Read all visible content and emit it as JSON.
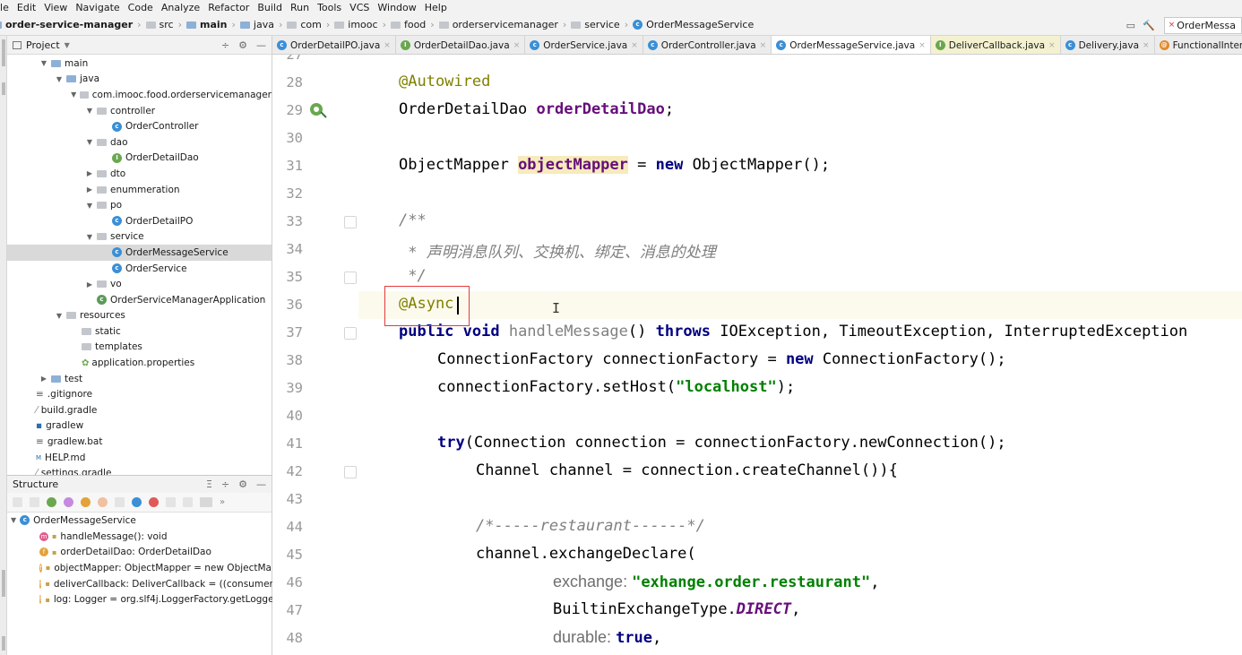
{
  "menu": [
    "ile",
    "Edit",
    "View",
    "Navigate",
    "Code",
    "Analyze",
    "Refactor",
    "Build",
    "Run",
    "Tools",
    "VCS",
    "Window",
    "Help"
  ],
  "breadcrumb": [
    "order-service-manager",
    "src",
    "main",
    "java",
    "com",
    "imooc",
    "food",
    "orderservicemanager",
    "service",
    "OrderMessageService"
  ],
  "nav_right_tab": "OrderMessa",
  "project_panel": {
    "title": "Project",
    "tree": [
      {
        "label": "main",
        "indent": 0,
        "arrow": "down",
        "icon": "folder-blue"
      },
      {
        "label": "java",
        "indent": 1,
        "arrow": "down",
        "icon": "folder-blue"
      },
      {
        "label": "com.imooc.food.orderservicemanager",
        "indent": 2,
        "arrow": "down",
        "icon": "folder"
      },
      {
        "label": "controller",
        "indent": 3,
        "arrow": "down",
        "icon": "folder"
      },
      {
        "label": "OrderController",
        "indent": 4,
        "arrow": "",
        "icon": "class"
      },
      {
        "label": "dao",
        "indent": 3,
        "arrow": "down",
        "icon": "folder"
      },
      {
        "label": "OrderDetailDao",
        "indent": 4,
        "arrow": "",
        "icon": "interface"
      },
      {
        "label": "dto",
        "indent": 3,
        "arrow": "right",
        "icon": "folder"
      },
      {
        "label": "enummeration",
        "indent": 3,
        "arrow": "right",
        "icon": "folder"
      },
      {
        "label": "po",
        "indent": 3,
        "arrow": "down",
        "icon": "folder"
      },
      {
        "label": "OrderDetailPO",
        "indent": 4,
        "arrow": "",
        "icon": "class"
      },
      {
        "label": "service",
        "indent": 3,
        "arrow": "down",
        "icon": "folder"
      },
      {
        "label": "OrderMessageService",
        "indent": 4,
        "arrow": "",
        "icon": "class",
        "selected": true
      },
      {
        "label": "OrderService",
        "indent": 4,
        "arrow": "",
        "icon": "class"
      },
      {
        "label": "vo",
        "indent": 3,
        "arrow": "right",
        "icon": "folder"
      },
      {
        "label": "OrderServiceManagerApplication",
        "indent": 3,
        "arrow": "",
        "icon": "app"
      },
      {
        "label": "resources",
        "indent": 1,
        "arrow": "down",
        "icon": "folder"
      },
      {
        "label": "static",
        "indent": 2,
        "arrow": "",
        "icon": "folder"
      },
      {
        "label": "templates",
        "indent": 2,
        "arrow": "",
        "icon": "folder"
      },
      {
        "label": "application.properties",
        "indent": 2,
        "arrow": "",
        "icon": "props"
      },
      {
        "label": "test",
        "indent": 0,
        "arrow": "right",
        "icon": "folder-blue"
      },
      {
        "label": ".gitignore",
        "indent": -1,
        "arrow": "",
        "icon": "file"
      },
      {
        "label": "build.gradle",
        "indent": -1,
        "arrow": "",
        "icon": "gradle"
      },
      {
        "label": "gradlew",
        "indent": -1,
        "arrow": "",
        "icon": "exec"
      },
      {
        "label": "gradlew.bat",
        "indent": -1,
        "arrow": "",
        "icon": "file"
      },
      {
        "label": "HELP.md",
        "indent": -1,
        "arrow": "",
        "icon": "md"
      },
      {
        "label": "settings.gradle",
        "indent": -1,
        "arrow": "",
        "icon": "gradle"
      }
    ]
  },
  "structure_panel": {
    "title": "Structure",
    "root": "OrderMessageService",
    "items": [
      {
        "badge": "m",
        "label": "handleMessage(): void"
      },
      {
        "badge": "f",
        "label": "orderDetailDao: OrderDetailDao"
      },
      {
        "badge": "f",
        "label": "objectMapper: ObjectMapper = new ObjectMa"
      },
      {
        "badge": "f",
        "label": "deliverCallback: DeliverCallback = ((consumerTa"
      },
      {
        "badge": "f",
        "label": "log: Logger = org.slf4j.LoggerFactory.getLogge"
      }
    ]
  },
  "tabs": [
    {
      "label": "OrderDetailPO.java",
      "icon": "class"
    },
    {
      "label": "OrderDetailDao.java",
      "icon": "interface"
    },
    {
      "label": "OrderService.java",
      "icon": "class"
    },
    {
      "label": "OrderController.java",
      "icon": "class"
    },
    {
      "label": "OrderMessageService.java",
      "icon": "class",
      "active": true
    },
    {
      "label": "DeliverCallback.java",
      "icon": "interface",
      "iface": true
    },
    {
      "label": "Delivery.java",
      "icon": "class"
    },
    {
      "label": "FunctionalInterface.java",
      "icon": "annotation"
    }
  ],
  "editor": {
    "first_partial_line": "27",
    "current_line": "36",
    "lines": [
      {
        "n": "28",
        "indent": 0,
        "tokens": [
          [
            "ann",
            "@Autowired"
          ]
        ]
      },
      {
        "n": "29",
        "indent": 0,
        "tokens": [
          [
            "",
            "OrderDetailDao "
          ],
          [
            "fld",
            "orderDetailDao"
          ],
          [
            "",
            ";"
          ]
        ],
        "gicon": true
      },
      {
        "n": "30",
        "indent": 0,
        "tokens": []
      },
      {
        "n": "31",
        "indent": 0,
        "tokens": [
          [
            "",
            "ObjectMapper "
          ],
          [
            "fld hl",
            "objectMapper"
          ],
          [
            "",
            " = "
          ],
          [
            "kw",
            "new"
          ],
          [
            "",
            " ObjectMapper();"
          ]
        ]
      },
      {
        "n": "32",
        "indent": 0,
        "tokens": []
      },
      {
        "n": "33",
        "indent": 0,
        "tokens": [
          [
            "cmt",
            "/**"
          ]
        ],
        "fold": true
      },
      {
        "n": "34",
        "indent": 0,
        "tokens": [
          [
            "cmt",
            " * 声明消息队列、交换机、绑定、消息的处理"
          ]
        ]
      },
      {
        "n": "35",
        "indent": 0,
        "tokens": [
          [
            "cmt",
            " */"
          ]
        ],
        "fold": true
      },
      {
        "n": "36",
        "indent": 0,
        "tokens": [
          [
            "ann",
            "@Async"
          ]
        ]
      },
      {
        "n": "37",
        "indent": 0,
        "tokens": [
          [
            "kw",
            "public void "
          ],
          [
            "gray",
            "handleMessage"
          ],
          [
            "",
            "() "
          ],
          [
            "kw",
            "throws"
          ],
          [
            "",
            " IOException, TimeoutException, InterruptedException"
          ]
        ],
        "fold": true
      },
      {
        "n": "38",
        "indent": 1,
        "tokens": [
          [
            "",
            "ConnectionFactory connectionFactory = "
          ],
          [
            "kw",
            "new"
          ],
          [
            "",
            " ConnectionFactory();"
          ]
        ]
      },
      {
        "n": "39",
        "indent": 1,
        "tokens": [
          [
            "",
            "connectionFactory.setHost("
          ],
          [
            "str",
            "\"localhost\""
          ],
          [
            "",
            ");"
          ]
        ]
      },
      {
        "n": "40",
        "indent": 0,
        "tokens": []
      },
      {
        "n": "41",
        "indent": 1,
        "tokens": [
          [
            "kw",
            "try"
          ],
          [
            "",
            "(Connection connection = connectionFactory.newConnection();"
          ]
        ]
      },
      {
        "n": "42",
        "indent": 2,
        "tokens": [
          [
            "",
            "Channel channel = connection.createChannel()){"
          ]
        ],
        "fold": true
      },
      {
        "n": "43",
        "indent": 0,
        "tokens": []
      },
      {
        "n": "44",
        "indent": 2,
        "tokens": [
          [
            "cmt",
            "/*-----restaurant------*/"
          ]
        ]
      },
      {
        "n": "45",
        "indent": 2,
        "tokens": [
          [
            "",
            "channel.exchangeDeclare("
          ]
        ]
      },
      {
        "n": "46",
        "indent": 4,
        "tokens": [
          [
            "hint",
            "exchange: "
          ],
          [
            "str",
            "\"exhange.order.restaurant\""
          ],
          [
            "",
            ","
          ]
        ]
      },
      {
        "n": "47",
        "indent": 4,
        "tokens": [
          [
            "",
            "BuiltinExchangeType."
          ],
          [
            "ital",
            "DIRECT"
          ],
          [
            "",
            ","
          ]
        ]
      },
      {
        "n": "48",
        "indent": 4,
        "tokens": [
          [
            "hint",
            "durable: "
          ],
          [
            "kw",
            "true"
          ],
          [
            "",
            ","
          ]
        ]
      }
    ]
  }
}
